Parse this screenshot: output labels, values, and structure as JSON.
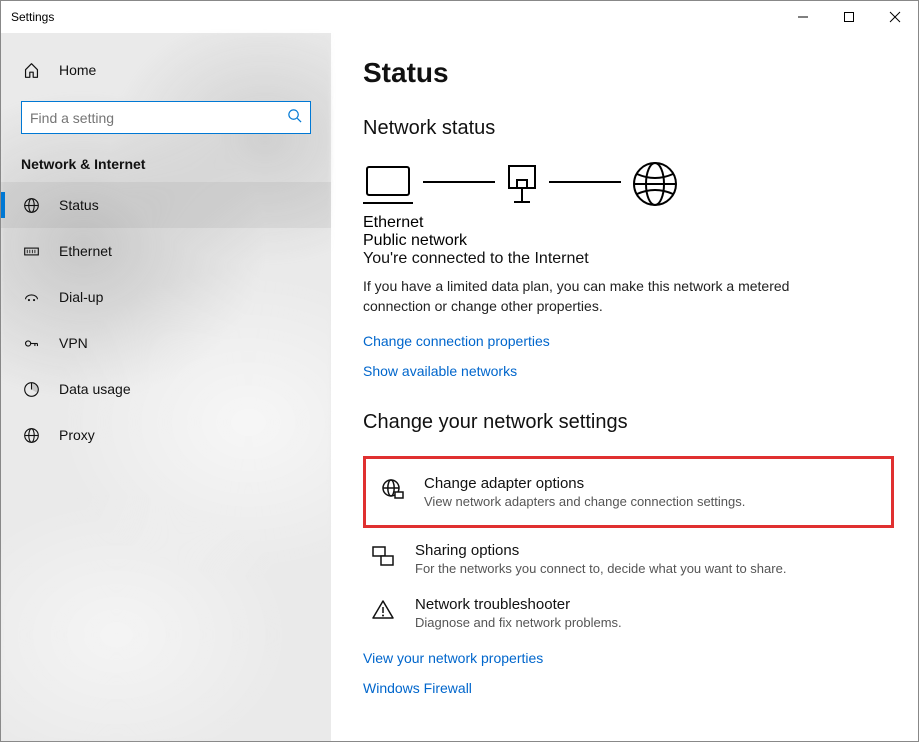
{
  "titlebar": {
    "title": "Settings"
  },
  "sidebar": {
    "home": "Home",
    "search_placeholder": "Find a setting",
    "category": "Network & Internet",
    "items": [
      {
        "id": "status",
        "label": "Status",
        "selected": true
      },
      {
        "id": "ethernet",
        "label": "Ethernet",
        "selected": false
      },
      {
        "id": "dialup",
        "label": "Dial-up",
        "selected": false
      },
      {
        "id": "vpn",
        "label": "VPN",
        "selected": false
      },
      {
        "id": "datausage",
        "label": "Data usage",
        "selected": false
      },
      {
        "id": "proxy",
        "label": "Proxy",
        "selected": false
      }
    ]
  },
  "main": {
    "title": "Status",
    "network_status_h": "Network status",
    "diagram": {
      "mid_top": "Ethernet",
      "mid_bottom": "Public network"
    },
    "connected_h": "You're connected to the Internet",
    "connected_desc": "If you have a limited data plan, you can make this network a metered connection or change other properties.",
    "link_change_props": "Change connection properties",
    "link_show_networks": "Show available networks",
    "settings_h": "Change your network settings",
    "items": [
      {
        "id": "adapter",
        "title": "Change adapter options",
        "desc": "View network adapters and change connection settings.",
        "highlight": true
      },
      {
        "id": "sharing",
        "title": "Sharing options",
        "desc": "For the networks you connect to, decide what you want to share.",
        "highlight": false
      },
      {
        "id": "trouble",
        "title": "Network troubleshooter",
        "desc": "Diagnose and fix network problems.",
        "highlight": false
      }
    ],
    "link_view_props": "View your network properties",
    "link_firewall": "Windows Firewall"
  }
}
